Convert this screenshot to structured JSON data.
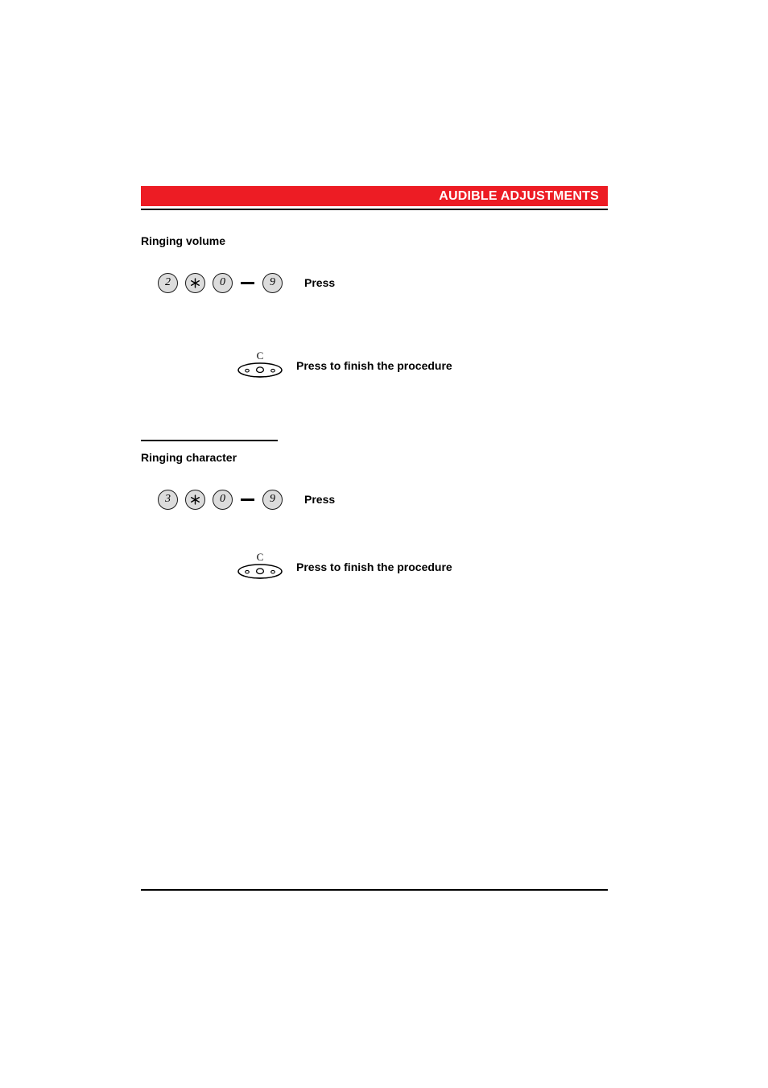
{
  "page": {
    "background_color": "#FFFFFF",
    "accent_color": "#ED1C24"
  },
  "header": {
    "title": "AUDIBLE ADJUSTMENTS",
    "banner_color": "#ED1C24",
    "title_color": "#FFFFFF"
  },
  "sections": [
    {
      "heading": "Ringing volume",
      "steps": [
        {
          "keys": [
            "2",
            "*",
            "0",
            "—",
            "9"
          ],
          "label": "Press"
        },
        {
          "keys": [
            "C"
          ],
          "label": "Press to finish the procedure"
        }
      ]
    },
    {
      "heading": "Ringing character",
      "steps": [
        {
          "keys": [
            "3",
            "*",
            "0",
            "—",
            "9"
          ],
          "label": "Press"
        },
        {
          "keys": [
            "C"
          ],
          "label": "Press to finish the procedure"
        }
      ]
    }
  ],
  "keys": {
    "volume_digit": "2",
    "character_digit": "3",
    "star": "*",
    "range_start": "0",
    "range_end": "9",
    "range_dash": "—",
    "clear_label": "C"
  },
  "labels": {
    "press": "Press",
    "press_finish": "Press to finish the procedure"
  }
}
